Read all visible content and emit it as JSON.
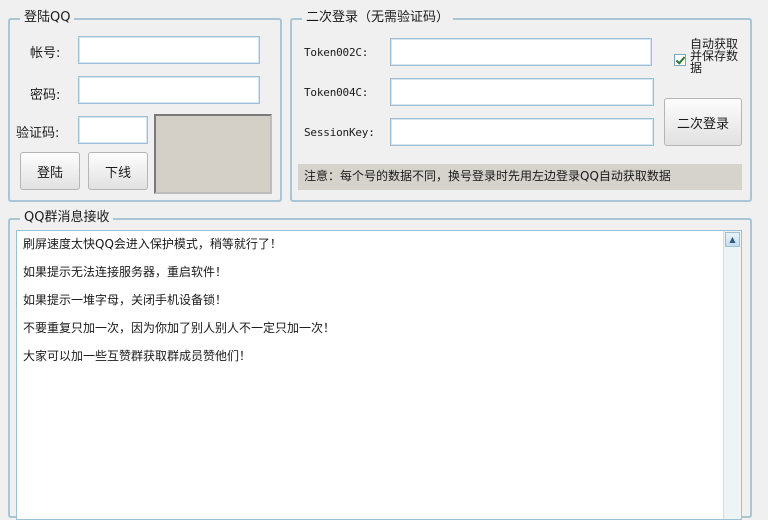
{
  "login_group": {
    "title": "登陆QQ",
    "account_label": "帐号:",
    "password_label": "密码:",
    "captcha_label": "验证码:",
    "login_button": "登陆",
    "logout_button": "下线"
  },
  "relogin_group": {
    "title": "二次登录（无需验证码）",
    "token002c_label": "Token002C:",
    "token004c_label": "Token004C:",
    "sessionkey_label": "SessionKey:",
    "auto_save_label": "自动获取并保存数据",
    "auto_save_checked": true,
    "relogin_button": "二次登录",
    "note": "注意：每个号的数据不同，换号登录时先用左边登录QQ自动获取数据"
  },
  "message_group": {
    "title": "QQ群消息接收",
    "lines": [
      "刷屏速度太快QQ会进入保护模式，稍等就行了！",
      "如果提示无法连接服务器，重启软件！",
      "如果提示一堆字母，关闭手机设备锁！",
      "不要重复只加一次，因为你加了别人别人不一定只加一次！",
      "大家可以加一些互赞群获取群成员赞他们！"
    ],
    "scroll_up_icon": "▲"
  }
}
